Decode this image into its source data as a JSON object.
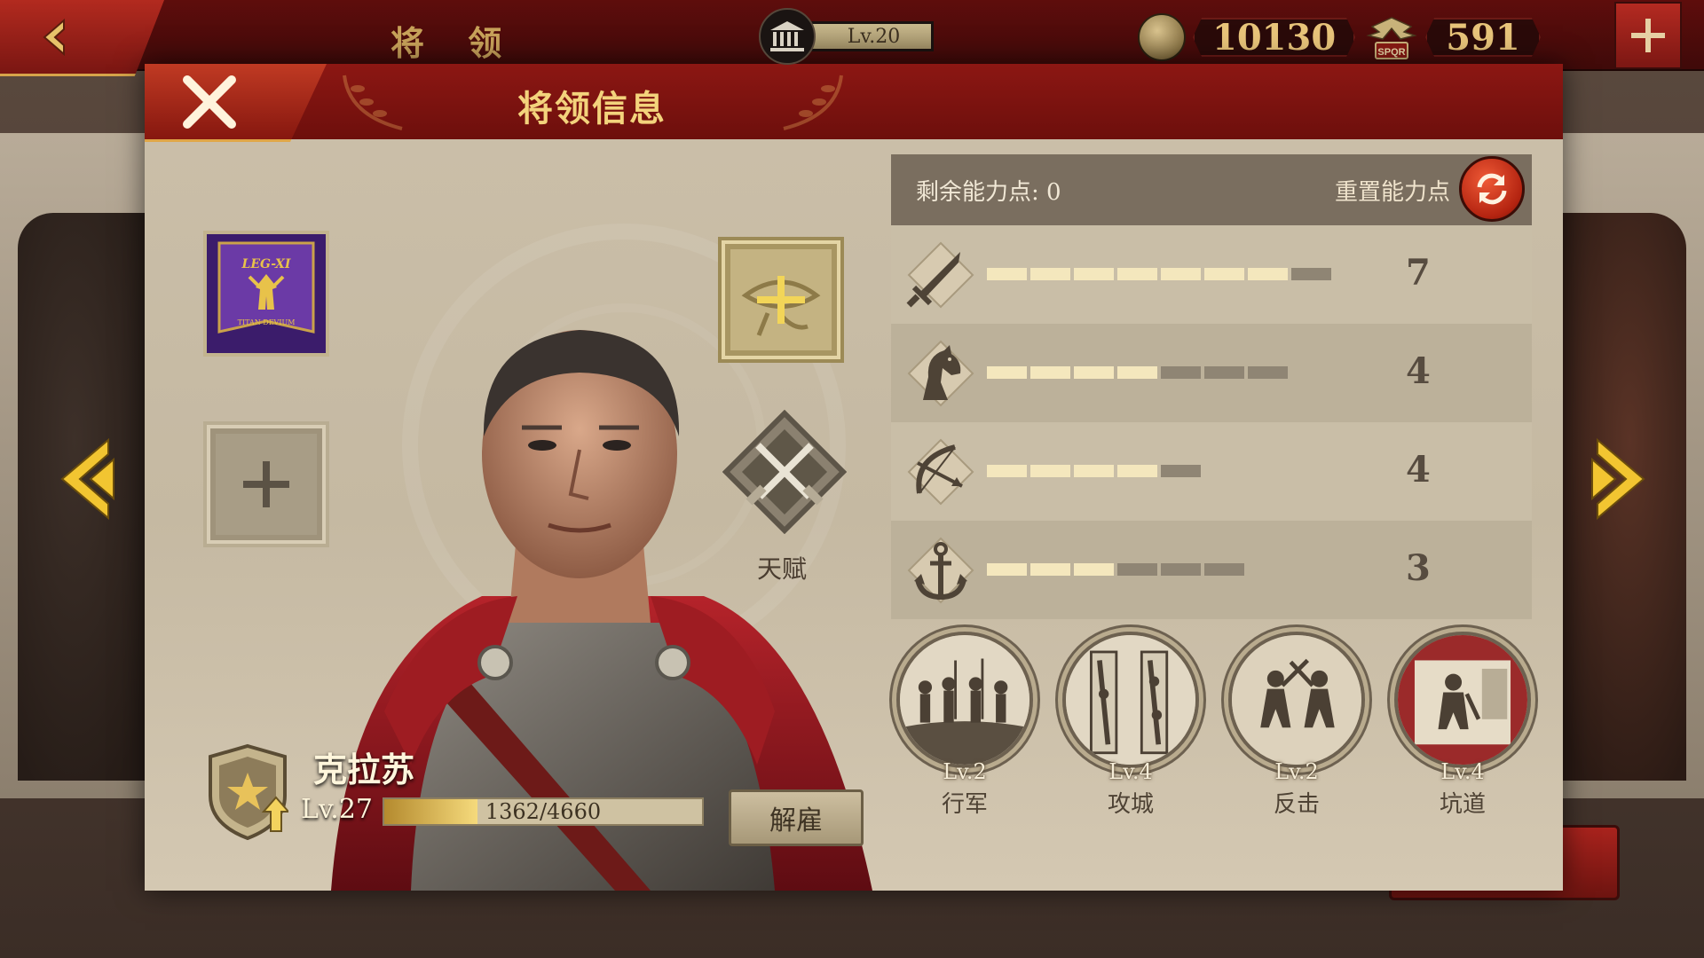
{
  "topbar": {
    "title": "将 领",
    "level": "Lv.20",
    "coins": "10130",
    "spqr_amount": "591",
    "spqr_label": "SPQR"
  },
  "modal": {
    "title": "将领信息"
  },
  "banner": {
    "text_top": "LEG-XI",
    "text_bottom": "TITAN DEVIUM"
  },
  "talent": {
    "label": "天赋"
  },
  "general": {
    "name": "克拉苏",
    "level": "Lv.27",
    "xp_text": "1362/4660",
    "xp_current": 1362,
    "xp_max": 4660,
    "dismiss_label": "解雇"
  },
  "stats": {
    "remaining_label": "剩余能力点: 0",
    "reset_label": "重置能力点",
    "rows": [
      {
        "icon": "sword-icon",
        "value": "7",
        "filled": 7,
        "total": 8
      },
      {
        "icon": "horse-icon",
        "value": "4",
        "filled": 4,
        "total": 7
      },
      {
        "icon": "bow-icon",
        "value": "4",
        "filled": 4,
        "total": 5
      },
      {
        "icon": "anchor-icon",
        "value": "3",
        "filled": 3,
        "total": 6
      }
    ]
  },
  "skills": [
    {
      "name": "行军",
      "level": "Lv.2",
      "icon": "march-icon"
    },
    {
      "name": "攻城",
      "level": "Lv.4",
      "icon": "siege-icon"
    },
    {
      "name": "反击",
      "level": "Lv.2",
      "icon": "counterattack-icon"
    },
    {
      "name": "坑道",
      "level": "Lv.4",
      "icon": "tunnel-icon"
    }
  ],
  "colors": {
    "top_bar": "#5e0d0c",
    "modal_header": "#8c1713",
    "title_gold": "#f3d37c",
    "stat_fill": "#f4e7bd",
    "stat_empty": "#8f8574",
    "reset_red": "#b32310"
  }
}
